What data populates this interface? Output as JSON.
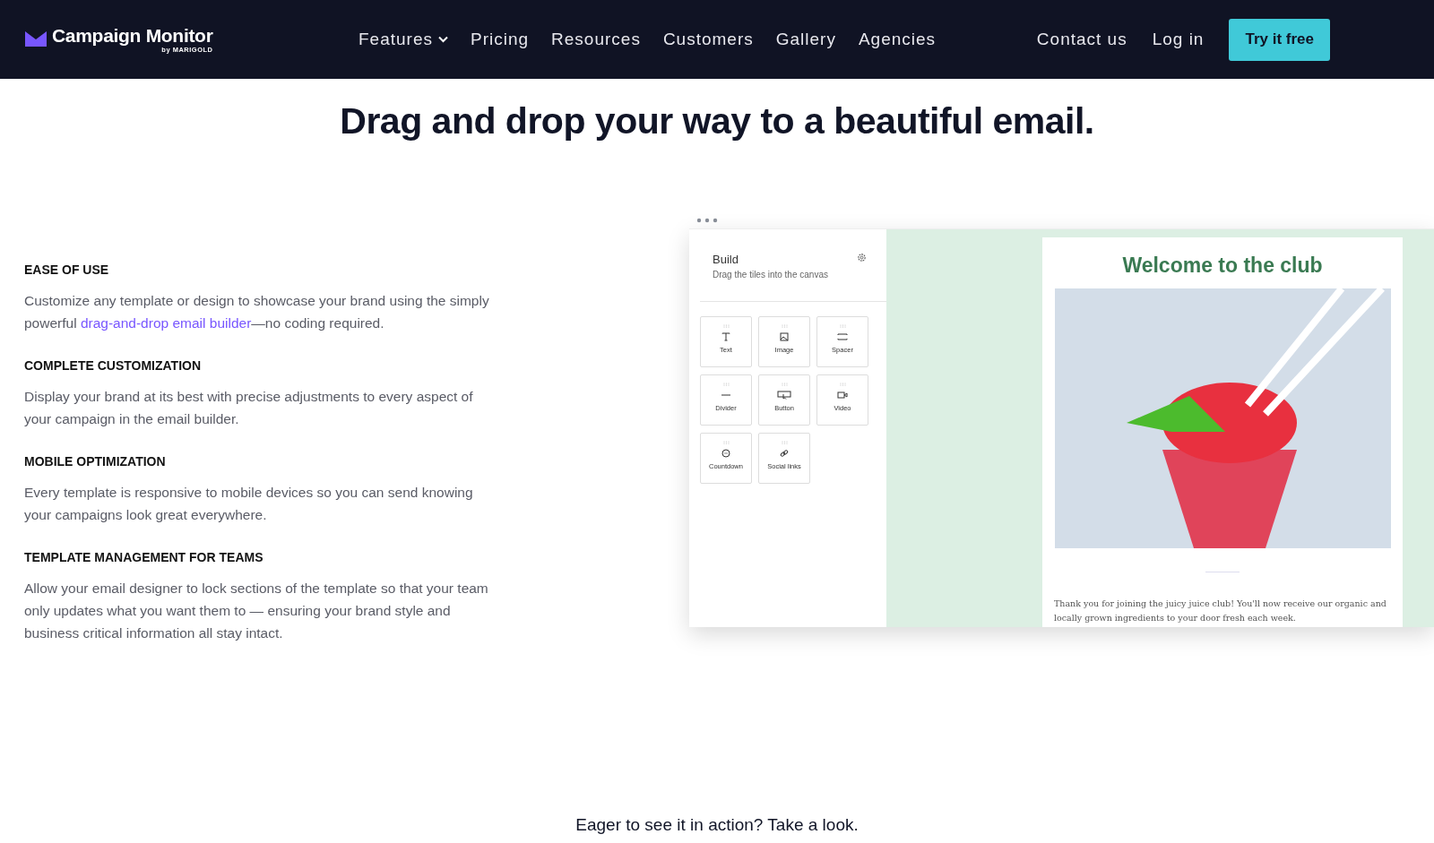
{
  "nav": {
    "brand": "Campaign Monitor",
    "brand_sub": "by MARIGOLD",
    "links": [
      {
        "label": "Features",
        "dropdown": true
      },
      {
        "label": "Pricing",
        "dropdown": false
      },
      {
        "label": "Resources",
        "dropdown": false
      },
      {
        "label": "Customers",
        "dropdown": false
      },
      {
        "label": "Gallery",
        "dropdown": false
      },
      {
        "label": "Agencies",
        "dropdown": false
      }
    ],
    "right_links": [
      "Contact us",
      "Log in"
    ],
    "cta": "Try it free"
  },
  "headline": "Drag and drop your way to a beautiful email.",
  "features": [
    {
      "title": "EASE OF USE",
      "body": "Customize any template or design to showcase your brand using the simply powerful ",
      "link": "drag-and-drop email builder",
      "after": "—no coding required."
    },
    {
      "title": "COMPLETE CUSTOMIZATION",
      "body": "Display your brand at its best with precise adjustments to every aspect of your campaign in the email builder."
    },
    {
      "title": "MOBILE OPTIMIZATION",
      "body": "Every template is responsive to mobile devices so you can send knowing your campaigns look great everywhere."
    },
    {
      "title": "TEMPLATE MANAGEMENT FOR TEAMS",
      "body": "Allow your email designer to lock sections of the template so that your team only updates what you want them to — ensuring your brand style and business critical information all stay intact."
    }
  ],
  "builder": {
    "title": "Build",
    "subtitle": "Drag the tiles into the canvas",
    "tiles": [
      {
        "label": "Text",
        "kind": "text"
      },
      {
        "label": "Image",
        "kind": "image"
      },
      {
        "label": "Spacer",
        "kind": "spacer"
      },
      {
        "label": "Divider",
        "kind": "divider"
      },
      {
        "label": "Button",
        "kind": "button"
      },
      {
        "label": "Video",
        "kind": "video"
      },
      {
        "label": "Countdown",
        "kind": "countdown"
      },
      {
        "label": "Social links",
        "kind": "social"
      }
    ]
  },
  "email": {
    "heading": "Welcome to the club",
    "text": "Thank you for joining the juicy juice club! You'll now receive our organic and locally grown ingredients to your door fresh each week."
  },
  "footer_text": "Eager to see it in action? Take a look."
}
